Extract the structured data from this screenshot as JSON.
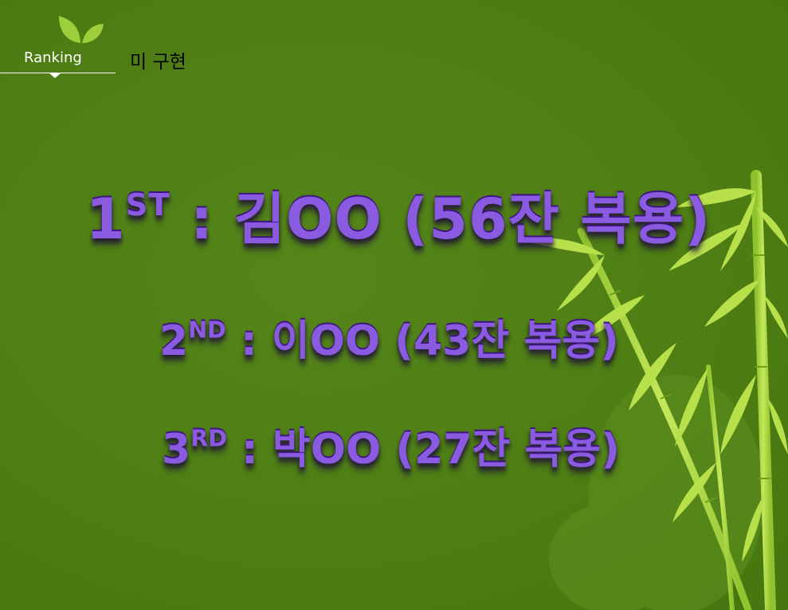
{
  "header": {
    "section_label": "Ranking",
    "note": "미 구현"
  },
  "rankings": [
    {
      "place_number": "1",
      "place_suffix": "ST",
      "separator": " : ",
      "name": "김OO",
      "detail": " (56잔 복용)"
    },
    {
      "place_number": "2",
      "place_suffix": "ND",
      "separator": " : ",
      "name": "이OO",
      "detail": " (43잔 복용)"
    },
    {
      "place_number": "3",
      "place_suffix": "RD",
      "separator": " : ",
      "name": "박OO",
      "detail": " (27잔 복용)"
    }
  ],
  "colors": {
    "background": "#4f7f14",
    "rank_text": "#6a2ec2",
    "leaf": "#9ccf3a",
    "bamboo": "#a9d63f"
  },
  "icons": {
    "header_logo": "leaf-icon",
    "decoration": "bamboo-illustration"
  }
}
